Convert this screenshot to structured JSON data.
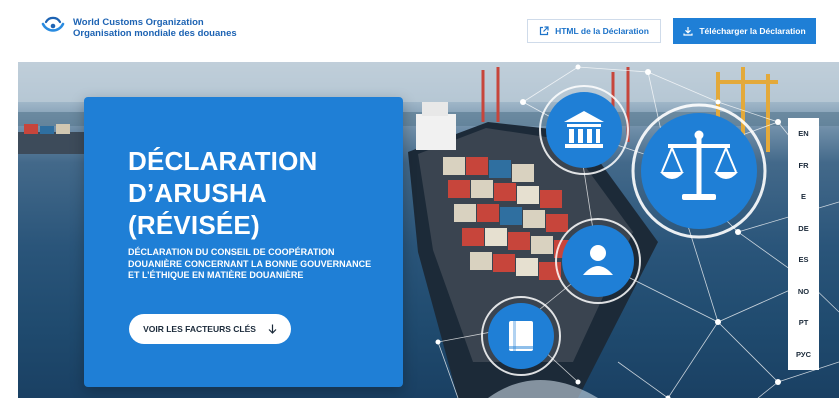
{
  "header": {
    "org_name_en": "World Customs Organization",
    "org_name_fr": "Organisation mondiale des douanes",
    "html_button": "HTML de la Déclaration",
    "download_button": "Télécharger la Déclaration"
  },
  "hero": {
    "title_lines": [
      "DÉCLARATION",
      "D’ARUSHA",
      "(RÉVISÉE)"
    ],
    "subtitle": "DÉCLARATION DU CONSEIL DE COOPÉRATION DOUANIÈRE CONCERNANT LA BONNE GOUVERNANCE ET L’ÉTHIQUE EN MATIÈRE DOUANIÈRE",
    "cta_label": "VOIR LES FACTEURS CLÉS"
  },
  "languages": [
    "EN",
    "FR",
    "E",
    "DE",
    "ES",
    "NO",
    "PT",
    "РУС"
  ],
  "icons": {
    "header": [
      "wco-logo-icon",
      "external-link-icon",
      "download-icon"
    ],
    "cta": "arrow-down-icon",
    "network": [
      "bank-building-icon",
      "scales-of-justice-icon",
      "person-icon",
      "book-icon"
    ]
  },
  "colors": {
    "brand_blue": "#1f7fd6",
    "logo_blue": "#1d63b3",
    "text_dark": "#1b2a3a"
  }
}
